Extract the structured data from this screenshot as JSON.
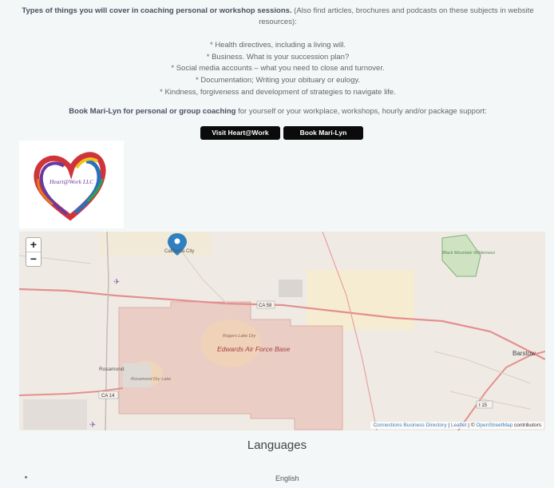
{
  "intro": {
    "bold": "Types of things you will cover in coaching personal or workshop sessions.",
    "rest": " (Also find articles, brochures and podcasts on these subjects in website resources):"
  },
  "topics": [
    "* Health directives, including a living will.",
    "* Business. What is your succession plan?",
    "* Social media accounts – what you need to close and turnover.",
    "* Documentation; Writing your obituary or eulogy.",
    "* Kindness, forgiveness and development of strategies to navigate life."
  ],
  "booking": {
    "bold": "Book Mari-Lyn for personal or group coaching",
    "rest": " for yourself or your workplace, workshops, hourly and/or package support:"
  },
  "buttons": {
    "visit": "Visit Heart@Work",
    "book": "Book Mari-Lyn"
  },
  "logo": {
    "text": "Heart@Work LLC"
  },
  "map": {
    "zoom_in": "+",
    "zoom_out": "−",
    "labels": {
      "california_city": "California City",
      "black_mountain": "Black Mountain Wilderness",
      "ca58": "CA 58",
      "rogers": "Rogers Lake Dry",
      "edwards": "Edwards Air Force Base",
      "rosamond": "Rosamond",
      "rosamond_lake": "Rosamond Dry Lake",
      "ca14": "CA 14",
      "barstow": "Barstow",
      "i15": "I 15"
    },
    "attribution": {
      "directory": "Connections Business Directory",
      "sep1": " | ",
      "leaflet": "Leaflet",
      "sep2": " | © ",
      "osm": "OpenStreetMap",
      "contrib": " contributors"
    }
  },
  "languages": {
    "title": "Languages",
    "items": [
      "English"
    ]
  },
  "colors": {
    "button_bg": "#0b0b0b",
    "marker": "#2f7fc1",
    "military_area": "#e9b8b0",
    "highway": "#e48f8f"
  }
}
